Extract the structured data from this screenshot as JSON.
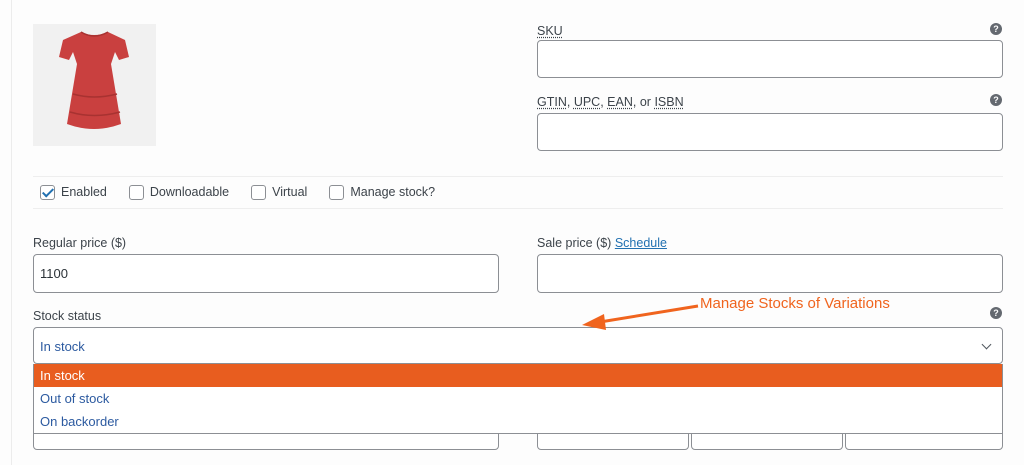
{
  "product": {
    "image_alt": "red dress product thumbnail"
  },
  "sku": {
    "label": "SKU",
    "value": ""
  },
  "gtin": {
    "label_parts": [
      "GTIN",
      "UPC",
      "EAN",
      "ISBN"
    ],
    "separator": ", ",
    "or": "or",
    "value": ""
  },
  "help_glyph": "?",
  "options": {
    "enabled": {
      "label": "Enabled",
      "checked": true
    },
    "downloadable": {
      "label": "Downloadable",
      "checked": false
    },
    "virtual": {
      "label": "Virtual",
      "checked": false
    },
    "manage_stock": {
      "label": "Manage stock?",
      "checked": false
    }
  },
  "regular_price": {
    "label": "Regular price ($)",
    "value": "1100"
  },
  "sale_price": {
    "label": "Sale price ($)",
    "schedule_link": "Schedule",
    "value": ""
  },
  "stock_status": {
    "label": "Stock status",
    "selected": "In stock",
    "options": [
      "In stock",
      "Out of stock",
      "On backorder"
    ],
    "highlighted_index": 0
  },
  "annotation": {
    "text": "Manage Stocks of Variations",
    "color": "#f0641e"
  },
  "colors": {
    "accent": "#2271b1",
    "highlight": "#e85d1f",
    "dress": "#c9403f"
  }
}
